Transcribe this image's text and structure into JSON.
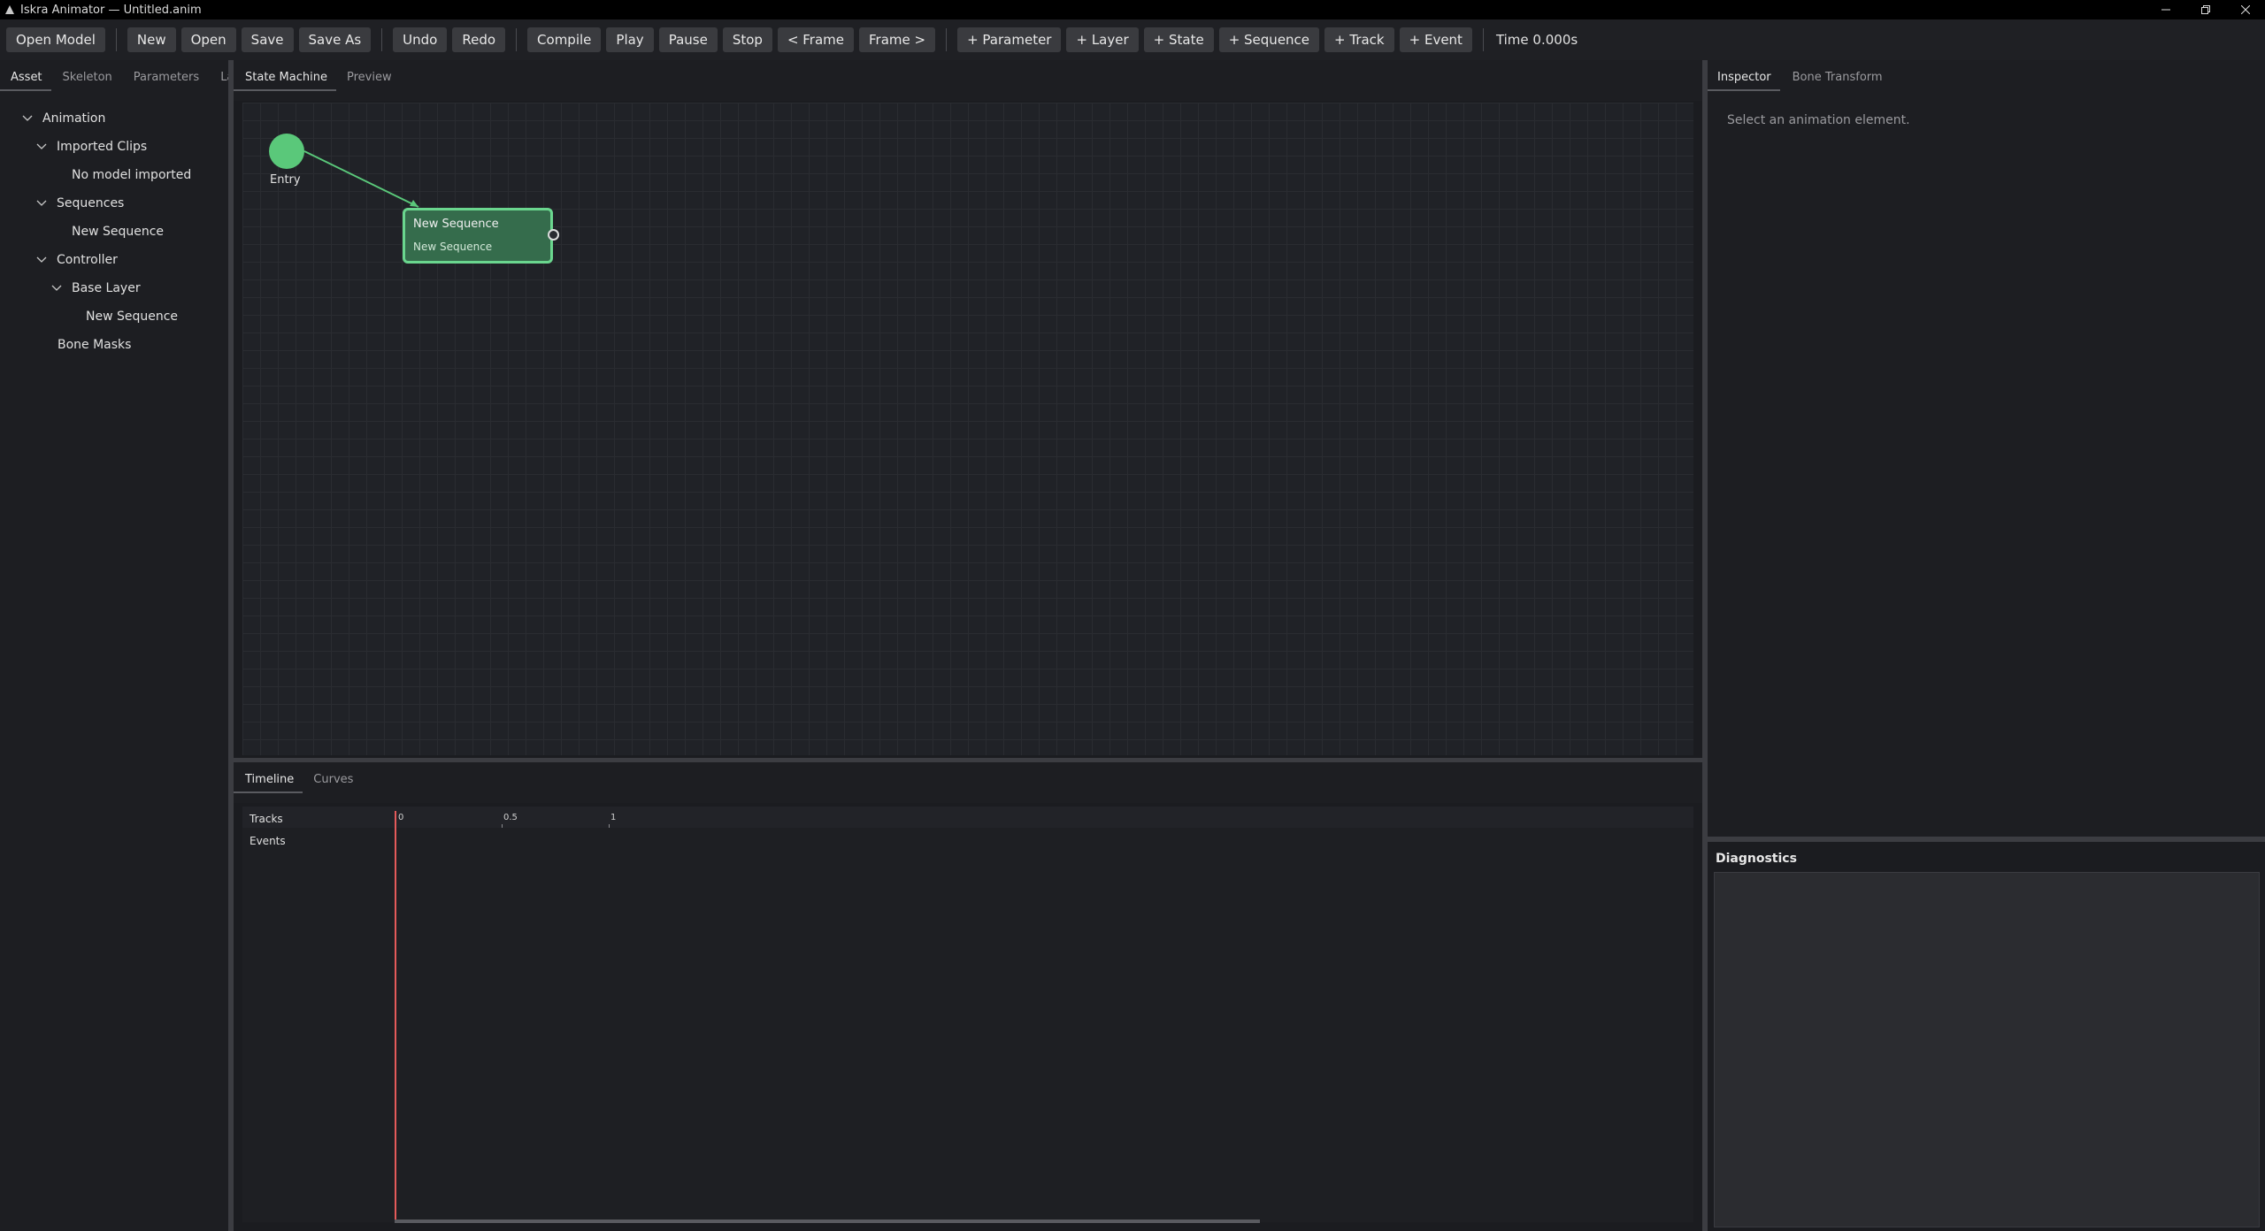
{
  "window": {
    "title": "Iskra Animator — Untitled.anim"
  },
  "toolbar": {
    "buttons": [
      "Open Model",
      "New",
      "Open",
      "Save",
      "Save As",
      "Undo",
      "Redo",
      "Compile",
      "Play",
      "Pause",
      "Stop",
      "< Frame",
      "Frame >",
      "+ Parameter",
      "+ Layer",
      "+ State",
      "+ Sequence",
      "+ Track",
      "+ Event"
    ],
    "time": "Time 0.000s"
  },
  "left_tabs": [
    "Asset",
    "Skeleton",
    "Parameters",
    "Layers"
  ],
  "tree": [
    {
      "label": "Animation",
      "depth": 0,
      "expanded": true
    },
    {
      "label": "Imported Clips",
      "depth": 1,
      "expanded": true
    },
    {
      "label": "No model imported",
      "depth": 2
    },
    {
      "label": "Sequences",
      "depth": 1,
      "expanded": true
    },
    {
      "label": "New Sequence",
      "depth": 2
    },
    {
      "label": "Controller",
      "depth": 1,
      "expanded": true
    },
    {
      "label": "Base Layer",
      "depth": 2,
      "expanded": true
    },
    {
      "label": "New Sequence",
      "depth": 3
    },
    {
      "label": "Bone Masks",
      "depth": 1
    }
  ],
  "center_tabs": [
    "State Machine",
    "Preview"
  ],
  "graph": {
    "entry_label": "Entry",
    "state": {
      "title": "New Sequence",
      "subtitle": "New Sequence"
    }
  },
  "bottom_tabs": [
    "Timeline",
    "Curves"
  ],
  "timeline": {
    "rows": [
      "Tracks",
      "Events"
    ],
    "ticks": [
      "0",
      "0.5",
      "1"
    ]
  },
  "right_tabs": [
    "Inspector",
    "Bone Transform"
  ],
  "inspector": {
    "hint": "Select an animation element."
  },
  "diagnostics": {
    "title": "Diagnostics"
  }
}
